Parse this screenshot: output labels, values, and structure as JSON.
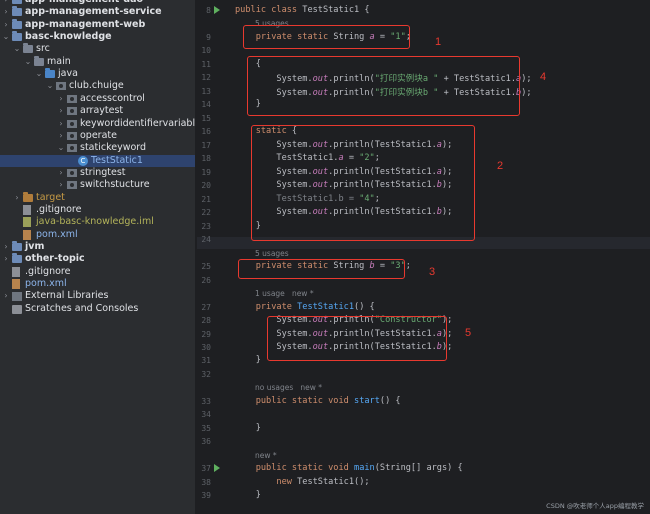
{
  "tree": {
    "rows": [
      {
        "label": "app-management-dao",
        "bold": true,
        "chev": "›",
        "icon": "module"
      },
      {
        "label": "app-management-service",
        "bold": true,
        "chev": "›",
        "icon": "module"
      },
      {
        "label": "app-management-web",
        "bold": true,
        "chev": "›",
        "icon": "module"
      },
      {
        "label": "basc-knowledge",
        "bold": true,
        "chev": "⌄",
        "icon": "module"
      },
      {
        "label": "src",
        "chev": "⌄",
        "icon": "folder"
      },
      {
        "label": "main",
        "chev": "⌄",
        "icon": "folder"
      },
      {
        "label": "java",
        "chev": "⌄",
        "icon": "src"
      },
      {
        "label": "club.chuige",
        "chev": "⌄",
        "icon": "pkg"
      },
      {
        "label": "accesscontrol",
        "chev": "›",
        "icon": "pkg"
      },
      {
        "label": "arraytest",
        "chev": "›",
        "icon": "pkg"
      },
      {
        "label": "keywordidentifiervariable",
        "chev": "›",
        "icon": "pkg"
      },
      {
        "label": "operate",
        "chev": "›",
        "icon": "pkg"
      },
      {
        "label": "statickeyword",
        "chev": "⌄",
        "icon": "pkg"
      },
      {
        "label": "TestStatic1",
        "chev": "",
        "icon": "class",
        "color": "blue",
        "selected": true
      },
      {
        "label": "stringtest",
        "chev": "›",
        "icon": "pkg"
      },
      {
        "label": "switchstucture",
        "chev": "›",
        "icon": "pkg"
      },
      {
        "label": "target",
        "chev": "›",
        "icon": "orange",
        "color": "orange"
      },
      {
        "label": ".gitignore",
        "chev": "",
        "icon": "file"
      },
      {
        "label": "java-basc-knowledge.iml",
        "chev": "",
        "icon": "iml",
        "color": "green"
      },
      {
        "label": "pom.xml",
        "chev": "",
        "icon": "m",
        "color": "blue"
      },
      {
        "label": "jvm",
        "bold": true,
        "chev": "›",
        "icon": "module"
      },
      {
        "label": "other-topic",
        "bold": true,
        "chev": "›",
        "icon": "module"
      },
      {
        "label": ".gitignore",
        "chev": "",
        "icon": "file"
      },
      {
        "label": "pom.xml",
        "chev": "",
        "icon": "m",
        "color": "blue"
      },
      {
        "label": "External Libraries",
        "chev": "›",
        "icon": "lib"
      },
      {
        "label": "Scratches and Consoles",
        "chev": "",
        "icon": "scratch"
      }
    ]
  },
  "editor": {
    "lines": [
      {
        "n": "8",
        "run": true,
        "parts": [
          [
            "kw",
            "public class "
          ],
          [
            "",
            "TestStatic1 {"
          ]
        ]
      },
      {
        "hint": "5 usages"
      },
      {
        "n": "9",
        "parts": [
          [
            "",
            "    "
          ],
          [
            "kw",
            "private static "
          ],
          [
            "",
            "String "
          ],
          [
            "fld",
            "a"
          ],
          [
            "",
            " = "
          ],
          [
            "str",
            "\"1\""
          ],
          [
            "",
            ";"
          ]
        ]
      },
      {
        "n": "10",
        "parts": []
      },
      {
        "n": "11",
        "parts": [
          [
            "",
            "    {"
          ]
        ]
      },
      {
        "n": "12",
        "parts": [
          [
            "",
            "        System."
          ],
          [
            "fld",
            "out"
          ],
          [
            "",
            ".println("
          ],
          [
            "str",
            "\"打印实例块a \""
          ],
          [
            "",
            " + TestStatic1."
          ],
          [
            "fld",
            "a"
          ],
          [
            "",
            ");"
          ]
        ]
      },
      {
        "n": "13",
        "parts": [
          [
            "",
            "        System."
          ],
          [
            "fld",
            "out"
          ],
          [
            "",
            ".println("
          ],
          [
            "str",
            "\"打印实例块b \""
          ],
          [
            "",
            " + TestStatic1."
          ],
          [
            "fld",
            "b"
          ],
          [
            "",
            ");"
          ]
        ]
      },
      {
        "n": "14",
        "parts": [
          [
            "",
            "    }"
          ]
        ]
      },
      {
        "n": "15",
        "parts": []
      },
      {
        "n": "16",
        "parts": [
          [
            "",
            "    "
          ],
          [
            "kw",
            "static "
          ],
          [
            "",
            "{"
          ]
        ]
      },
      {
        "n": "17",
        "parts": [
          [
            "",
            "        System."
          ],
          [
            "fld",
            "out"
          ],
          [
            "",
            ".println(TestStatic1."
          ],
          [
            "fld",
            "a"
          ],
          [
            "",
            ");"
          ]
        ]
      },
      {
        "n": "18",
        "parts": [
          [
            "",
            "        TestStatic1."
          ],
          [
            "fld",
            "a"
          ],
          [
            "",
            " = "
          ],
          [
            "str",
            "\"2\""
          ],
          [
            "",
            ";"
          ]
        ]
      },
      {
        "n": "19",
        "parts": [
          [
            "",
            "        System."
          ],
          [
            "fld",
            "out"
          ],
          [
            "",
            ".println(TestStatic1."
          ],
          [
            "fld",
            "a"
          ],
          [
            "",
            ");"
          ]
        ]
      },
      {
        "n": "20",
        "parts": [
          [
            "",
            "        System."
          ],
          [
            "fld",
            "out"
          ],
          [
            "",
            ".println(TestStatic1."
          ],
          [
            "fld",
            "b"
          ],
          [
            "",
            ");"
          ]
        ]
      },
      {
        "n": "21",
        "parts": [
          [
            "gray",
            "        TestStatic1.b = "
          ],
          [
            "str",
            "\"4\""
          ],
          [
            "",
            ";"
          ]
        ]
      },
      {
        "n": "22",
        "parts": [
          [
            "",
            "        System."
          ],
          [
            "fld",
            "out"
          ],
          [
            "",
            ".println(TestStatic1."
          ],
          [
            "fld",
            "b"
          ],
          [
            "",
            ");"
          ]
        ]
      },
      {
        "n": "23",
        "parts": [
          [
            "",
            "    }"
          ]
        ]
      },
      {
        "n": "24",
        "parts": [],
        "current": true
      },
      {
        "hint": "5 usages"
      },
      {
        "n": "25",
        "parts": [
          [
            "",
            "    "
          ],
          [
            "kw",
            "private static "
          ],
          [
            "",
            "String "
          ],
          [
            "fld",
            "b"
          ],
          [
            "",
            " = "
          ],
          [
            "str",
            "\"3\""
          ],
          [
            "",
            ";"
          ]
        ]
      },
      {
        "n": "26",
        "parts": []
      },
      {
        "hint": "1 usage   new *"
      },
      {
        "n": "27",
        "parts": [
          [
            "",
            "    "
          ],
          [
            "kw",
            "private "
          ],
          [
            "fn",
            "TestStatic1"
          ],
          [
            "",
            "() {"
          ]
        ]
      },
      {
        "n": "28",
        "parts": [
          [
            "",
            "        System."
          ],
          [
            "fld",
            "out"
          ],
          [
            "",
            ".println("
          ],
          [
            "str",
            "\"Constructor\""
          ],
          [
            "",
            ");"
          ]
        ]
      },
      {
        "n": "29",
        "parts": [
          [
            "",
            "        System."
          ],
          [
            "fld",
            "out"
          ],
          [
            "",
            ".println(TestStatic1."
          ],
          [
            "fld",
            "a"
          ],
          [
            "",
            ");"
          ]
        ]
      },
      {
        "n": "30",
        "parts": [
          [
            "",
            "        System."
          ],
          [
            "fld",
            "out"
          ],
          [
            "",
            ".println(TestStatic1."
          ],
          [
            "fld",
            "b"
          ],
          [
            "",
            ");"
          ]
        ]
      },
      {
        "n": "31",
        "parts": [
          [
            "",
            "    }"
          ]
        ]
      },
      {
        "n": "32",
        "parts": []
      },
      {
        "hint": "no usages   new *"
      },
      {
        "n": "33",
        "parts": [
          [
            "",
            "    "
          ],
          [
            "kw",
            "public static void "
          ],
          [
            "fn",
            "start"
          ],
          [
            "",
            "() {"
          ]
        ]
      },
      {
        "n": "34",
        "parts": []
      },
      {
        "n": "35",
        "parts": [
          [
            "",
            "    }"
          ]
        ]
      },
      {
        "n": "36",
        "parts": []
      },
      {
        "hint": "new *"
      },
      {
        "n": "37",
        "run": true,
        "parts": [
          [
            "",
            "    "
          ],
          [
            "kw",
            "public static void "
          ],
          [
            "fn",
            "main"
          ],
          [
            "",
            "(String[] args) {"
          ]
        ]
      },
      {
        "n": "38",
        "parts": [
          [
            "",
            "        "
          ],
          [
            "kw",
            "new "
          ],
          [
            "",
            "TestStatic1();"
          ]
        ]
      },
      {
        "n": "39",
        "parts": [
          [
            "",
            "    }"
          ]
        ]
      }
    ]
  },
  "annotations": [
    {
      "label": "1"
    },
    {
      "label": "4"
    },
    {
      "label": "2"
    },
    {
      "label": "3"
    },
    {
      "label": "5"
    }
  ],
  "watermark": "CSDN @吹老师个人app编程教学",
  "colors": {
    "highlight_box": "#e8392f",
    "selected_row": "#2e436e"
  }
}
